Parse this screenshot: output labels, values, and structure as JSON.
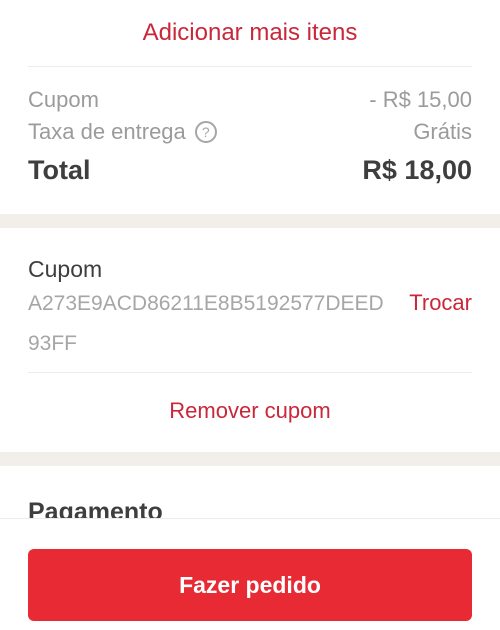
{
  "add_more_label": "Adicionar mais itens",
  "summary": {
    "coupon_label": "Cupom",
    "coupon_value": "- R$ 15,00",
    "delivery_label": "Taxa de entrega",
    "delivery_help_icon": "?",
    "delivery_value": "Grátis",
    "total_label": "Total",
    "total_value": "R$ 18,00"
  },
  "coupon": {
    "title": "Cupom",
    "code": "A273E9ACD86211E8B5192577DEED93FF",
    "change_label": "Trocar",
    "remove_label": "Remover cupom"
  },
  "payment": {
    "title": "Pagamento"
  },
  "order_button_label": "Fazer pedido",
  "colors": {
    "accent": "#e72a33",
    "link": "#c9283a",
    "muted_text": "#9b9b9b",
    "divider_band": "#f2efeb"
  }
}
